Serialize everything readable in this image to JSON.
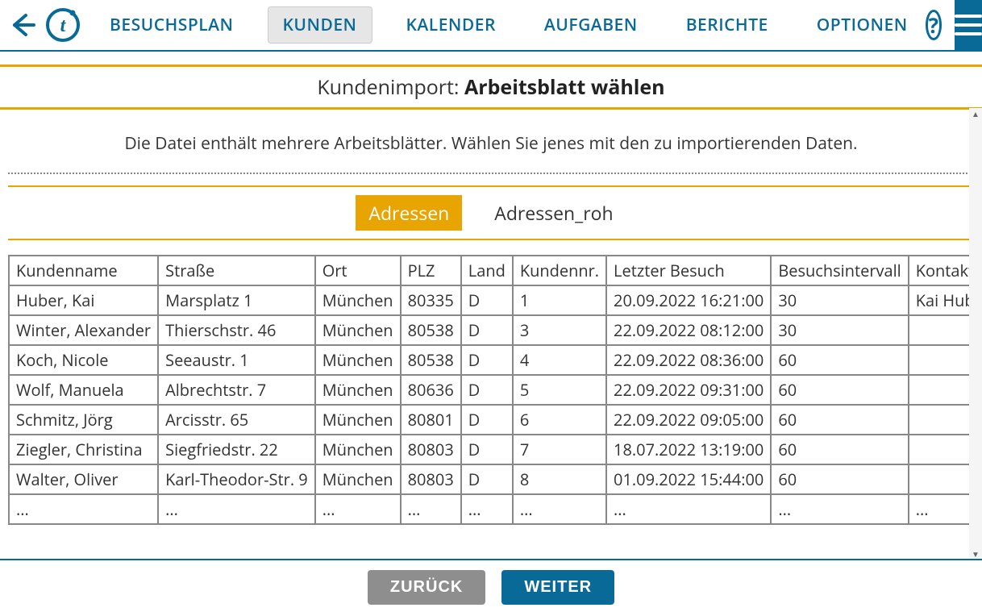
{
  "nav": {
    "items": [
      {
        "label": "BESUCHSPLAN",
        "active": false
      },
      {
        "label": "KUNDEN",
        "active": true
      },
      {
        "label": "KALENDER",
        "active": false
      },
      {
        "label": "AUFGABEN",
        "active": false
      },
      {
        "label": "BERICHTE",
        "active": false
      },
      {
        "label": "OPTIONEN",
        "active": false
      }
    ],
    "help_symbol": "?"
  },
  "title": {
    "prefix": "Kundenimport: ",
    "main": "Arbeitsblatt wählen"
  },
  "instruction": "Die Datei enthält mehrere Arbeitsblätter. Wählen Sie jenes mit den zu importierenden Daten.",
  "sheet_tabs": [
    {
      "label": "Adressen",
      "active": true
    },
    {
      "label": "Adressen_roh",
      "active": false
    }
  ],
  "table": {
    "headers": [
      "Kundenname",
      "Straße",
      "Ort",
      "PLZ",
      "Land",
      "Kundennr.",
      "Letzter Besuch",
      "Besuchsintervall",
      "Kontakt"
    ],
    "rows": [
      [
        "Huber, Kai",
        "Marsplatz 1",
        "München",
        "80335",
        "D",
        "1",
        "20.09.2022 16:21:00",
        "30",
        "Kai Huber"
      ],
      [
        "Winter, Alexander",
        "Thierschstr. 46",
        "München",
        "80538",
        "D",
        "3",
        "22.09.2022 08:12:00",
        "30",
        ""
      ],
      [
        "Koch, Nicole",
        "Seeaustr. 1",
        "München",
        "80538",
        "D",
        "4",
        "22.09.2022 08:36:00",
        "60",
        ""
      ],
      [
        "Wolf, Manuela",
        "Albrechtstr. 7",
        "München",
        "80636",
        "D",
        "5",
        "22.09.2022 09:31:00",
        "60",
        ""
      ],
      [
        "Schmitz, Jörg",
        "Arcisstr. 65",
        "München",
        "80801",
        "D",
        "6",
        "22.09.2022 09:05:00",
        "60",
        ""
      ],
      [
        "Ziegler, Christina",
        "Siegfriedstr. 22",
        "München",
        "80803",
        "D",
        "7",
        "18.07.2022 13:19:00",
        "60",
        ""
      ],
      [
        "Walter, Oliver",
        "Karl-Theodor-Str. 9",
        "München",
        "80803",
        "D",
        "8",
        "01.09.2022 15:44:00",
        "60",
        ""
      ],
      [
        "...",
        "...",
        "...",
        "...",
        "...",
        "...",
        "...",
        "...",
        "..."
      ]
    ]
  },
  "footer": {
    "back": "ZURÜCK",
    "next": "WEITER"
  }
}
